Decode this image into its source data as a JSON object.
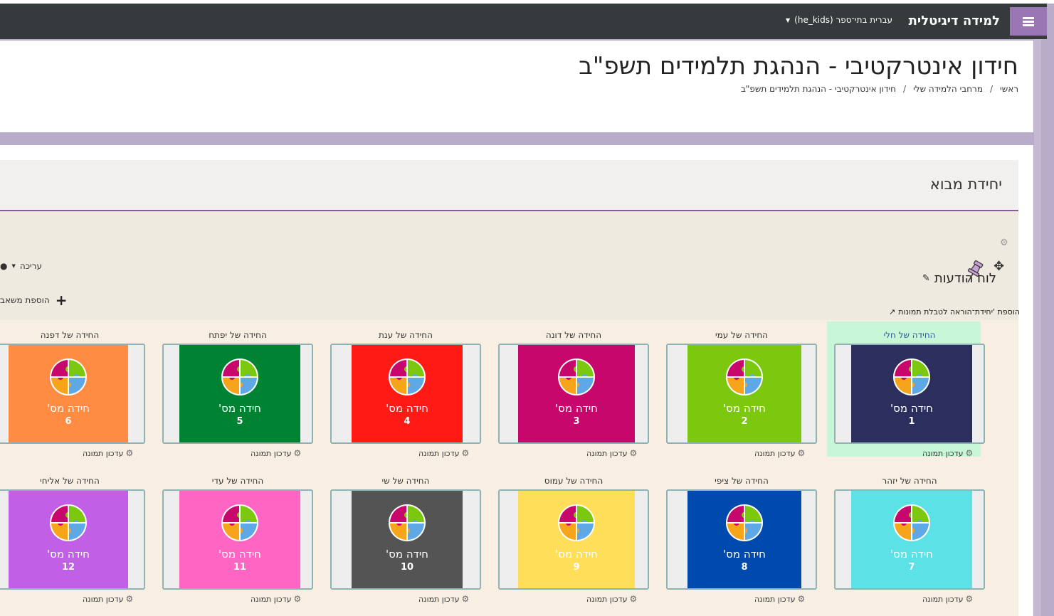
{
  "navbar": {
    "site_name": "למידה דיגיטלית",
    "language": "עברית בתי־ספר (he_kids)",
    "menu_icon": "hamburger-icon"
  },
  "page": {
    "title": "חידון אינטרקטיבי - הנהגת תלמידים תשפ\"ב",
    "breadcrumb": [
      "ראשי",
      "מרחבי הלמידה שלי",
      "חידון אינטרקטיבי - הנהגת תלמידים תשפ\"ב"
    ]
  },
  "section": {
    "title": "יחידת מבוא",
    "forum_label": "לוח הודעות",
    "edit_label": "עריכה",
    "add_activity_label": "הוספת משאב",
    "add_label_text": "הוספת 'יחידת־הוראה לטבלת תמונות"
  },
  "grid": {
    "tile_caption": "חידה מס'",
    "update_label": "עדכון תמונה",
    "tiles": [
      {
        "title": "החידה של חלי",
        "number": "1",
        "color": "#2c2e5e",
        "selected": true
      },
      {
        "title": "החידה של עמי",
        "number": "2",
        "color": "#7cc80f"
      },
      {
        "title": "החידה של דונה",
        "number": "3",
        "color": "#c8076d"
      },
      {
        "title": "החידה של ענת",
        "number": "4",
        "color": "#ff1a16"
      },
      {
        "title": "החידה של יפתח",
        "number": "5",
        "color": "#008233"
      },
      {
        "title": "החידה של דפנה",
        "number": "6",
        "color": "#ff8c42"
      },
      {
        "title": "החידה של יזהר",
        "number": "7",
        "color": "#5ce1e6"
      },
      {
        "title": "החידה של ציפי",
        "number": "8",
        "color": "#004aad"
      },
      {
        "title": "החידה של עמוס",
        "number": "9",
        "color": "#ffde59"
      },
      {
        "title": "החידה של שי",
        "number": "10",
        "color": "#545454"
      },
      {
        "title": "החידה של עדי",
        "number": "11",
        "color": "#ff66c4"
      },
      {
        "title": "החידה של אליחי",
        "number": "12",
        "color": "#c160e6"
      }
    ]
  }
}
